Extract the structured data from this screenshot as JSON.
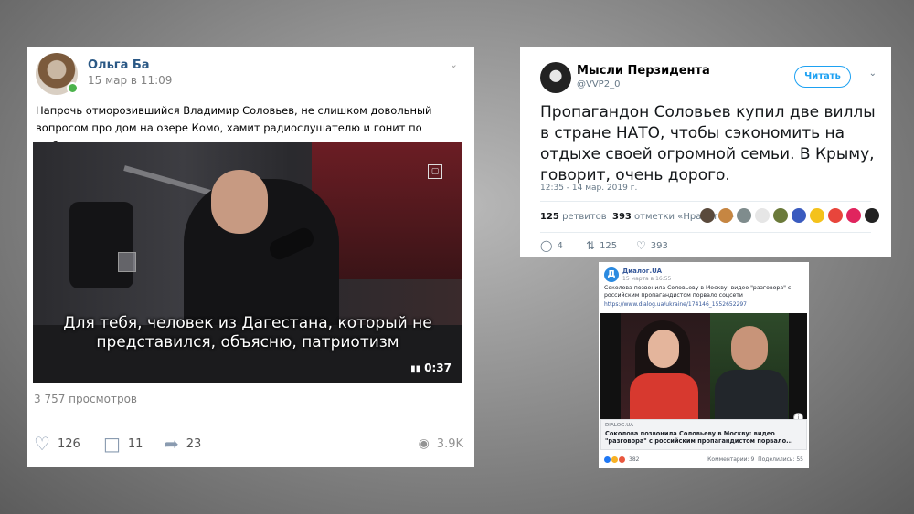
{
  "vk": {
    "author": "Ольга Ба",
    "date": "15 мар в 11:09",
    "text": "Напрочь отморозившийся Владимир Соловьев, не слишком довольный вопросом про дом на озере Комо, хамит радиослушателю и гонит по шаблону ...",
    "video_subtitle": "Для тебя, человек из Дагестана, который не представился, объясню, патриотизм",
    "video_duration": "0:37",
    "views": "3 757 просмотров",
    "likes": "126",
    "comments": "11",
    "shares": "23",
    "view_count": "3.9K",
    "icons": {
      "like": "heart-icon",
      "comment": "comment-icon",
      "share": "share-icon",
      "views": "eye-icon"
    }
  },
  "twitter": {
    "name": "Мысли Перзидента",
    "handle": "@VVP2_0",
    "follow_label": "Читать",
    "text": "Пропагандон Соловьев купил две виллы в стране НАТО, чтобы сэкономить на отдыхе своей огромной семьи. В Крыму, говорит, очень дорого.",
    "meta": "12:35 - 14 мар. 2019 г.",
    "retweets_count": "125",
    "retweets_label": "ретвитов",
    "likes_count": "393",
    "likes_label": "отметки «Нравится»",
    "replies": "4",
    "retweets": "125",
    "likes": "393",
    "accent": "#1da1f2",
    "liker_colors": [
      "#5a4a3c",
      "#c68642",
      "#7f8c8d",
      "#e6e6e6",
      "#6b7a3a",
      "#3a5bbf",
      "#f4c21b",
      "#e8453c",
      "#e0245e",
      "#222222"
    ]
  },
  "facebook": {
    "page": "Диалог.UA",
    "logo_letter": "Д",
    "date": "15 марта в 16:55",
    "text": "Соколова позвонила Соловьеву в Москву: видео \"разговора\" с российским пропагандистом порвало соцсети",
    "link": "https://www.dialog.ua/ukraine/174146_1552652297",
    "domain": "DIALOG.UA",
    "link_title": "Соколова позвонила Соловьеву в Москву: видео \"разговора\" с российским пропагандистом порвало...",
    "reactions": "382",
    "comments_label": "Комментарии: 9",
    "shares_label": "Поделились: 55",
    "accent": "#365899"
  }
}
